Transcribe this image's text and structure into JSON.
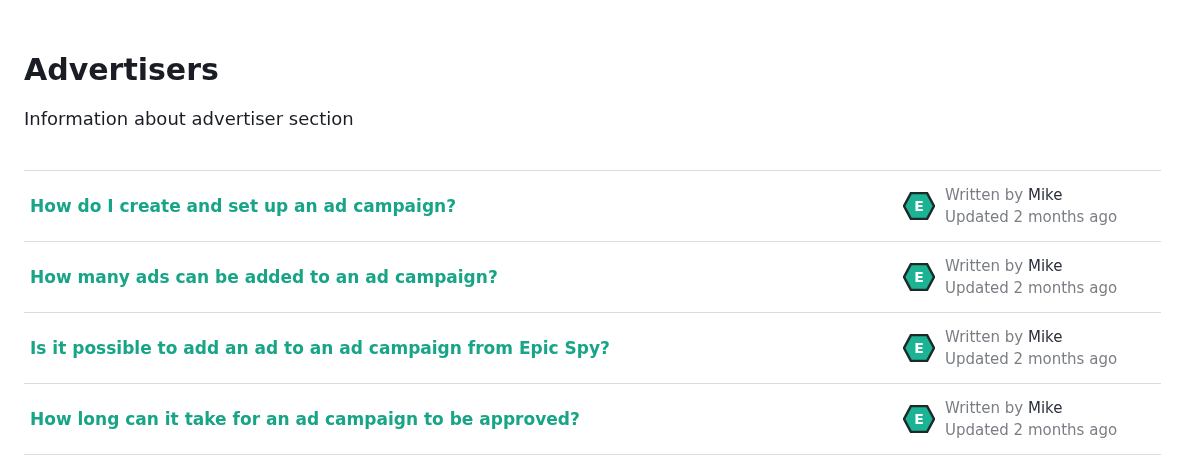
{
  "title": "Advertisers",
  "description": "Information about advertiser section",
  "articles": [
    {
      "title": "How do I create and set up an ad campaign?",
      "avatar_letter": "E",
      "written_by": "Written by",
      "author": "Mike",
      "updated": "Updated 2 months ago"
    },
    {
      "title": "How many ads can be added to an ad campaign?",
      "avatar_letter": "E",
      "written_by": "Written by",
      "author": "Mike",
      "updated": "Updated 2 months ago"
    },
    {
      "title": "Is it possible to add an ad to an ad campaign from Epic Spy?",
      "avatar_letter": "E",
      "written_by": "Written by",
      "author": "Mike",
      "updated": "Updated 2 months ago"
    },
    {
      "title": "How long can it take for an ad campaign to be approved?",
      "avatar_letter": "E",
      "written_by": "Written by",
      "author": "Mike",
      "updated": "Updated 2 months ago"
    }
  ]
}
